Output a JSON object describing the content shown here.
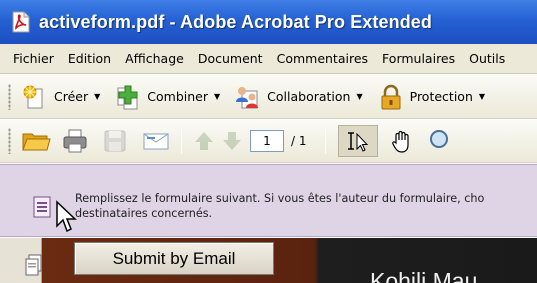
{
  "window": {
    "title": "activeform.pdf - Adobe Acrobat Pro Extended"
  },
  "menubar": {
    "items": [
      "Fichier",
      "Edition",
      "Affichage",
      "Document",
      "Commentaires",
      "Formulaires",
      "Outils"
    ]
  },
  "toolbar1": {
    "create_label": "Créer",
    "combine_label": "Combiner",
    "collaboration_label": "Collaboration",
    "protection_label": "Protection"
  },
  "toolbar2": {
    "page_number": "1",
    "page_total": "/ 1"
  },
  "infobar": {
    "message_line1": "Remplissez le formulaire suivant. Si vous êtes l'auteur du formulaire, cho",
    "message_line2": "destinataires concernés."
  },
  "document": {
    "submit_label": "Submit by Email",
    "heading": "Kohili Mau"
  },
  "colors": {
    "titlebar": "#2561d4",
    "menubar": "#ece9d8",
    "infobar": "#dfd3e6",
    "document_brown": "#6b2b12"
  }
}
